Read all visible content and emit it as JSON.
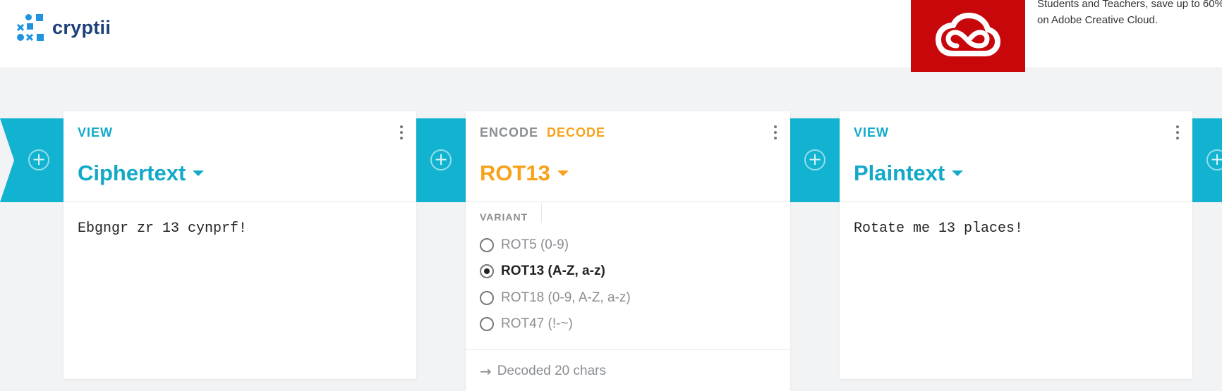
{
  "header": {
    "logo_text": "cryptii",
    "ad_text": "Students and Teachers, save up to 60% on Adobe Creative Cloud.",
    "ad_color": "#c8070b"
  },
  "colors": {
    "accent_blue": "#12a9c8",
    "accent_orange": "#f7a21b",
    "pipe_blue": "#12b3d1"
  },
  "bricks": [
    {
      "label": "VIEW",
      "title": "Ciphertext",
      "content": "Ebgngr zr 13 cynprf!"
    },
    {
      "encode_label": "ENCODE",
      "decode_label": "DECODE",
      "title": "ROT13",
      "variant_label": "VARIANT",
      "options": [
        {
          "label": "ROT5 (0-9)",
          "selected": false
        },
        {
          "label": "ROT13 (A-Z, a-z)",
          "selected": true
        },
        {
          "label": "ROT18 (0-9, A-Z, a-z)",
          "selected": false
        },
        {
          "label": "ROT47 (!-~)",
          "selected": false
        }
      ],
      "status": "Decoded 20 chars"
    },
    {
      "label": "VIEW",
      "title": "Plaintext",
      "content": "Rotate me 13 places!"
    }
  ],
  "icons": {
    "add": "plus-circle-icon",
    "menu": "vertical-dots-icon",
    "dropdown": "caret-down-icon",
    "status": "arrow-right-icon"
  }
}
